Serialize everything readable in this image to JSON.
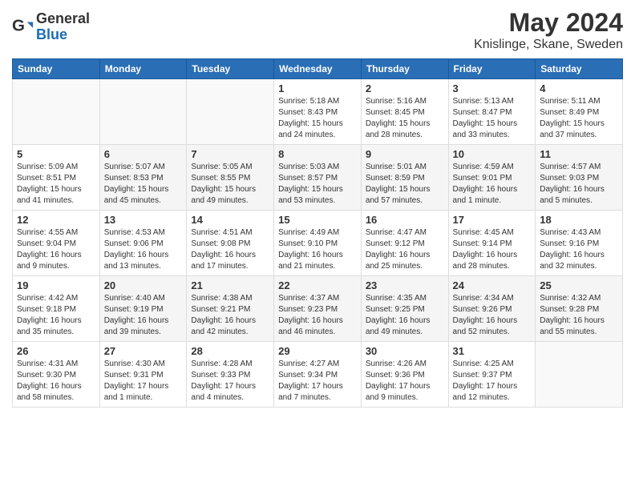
{
  "header": {
    "logo_general": "General",
    "logo_blue": "Blue",
    "main_title": "May 2024",
    "subtitle": "Knislinge, Skane, Sweden"
  },
  "weekdays": [
    "Sunday",
    "Monday",
    "Tuesday",
    "Wednesday",
    "Thursday",
    "Friday",
    "Saturday"
  ],
  "weeks": [
    [
      {
        "day": "",
        "info": ""
      },
      {
        "day": "",
        "info": ""
      },
      {
        "day": "",
        "info": ""
      },
      {
        "day": "1",
        "info": "Sunrise: 5:18 AM\nSunset: 8:43 PM\nDaylight: 15 hours\nand 24 minutes."
      },
      {
        "day": "2",
        "info": "Sunrise: 5:16 AM\nSunset: 8:45 PM\nDaylight: 15 hours\nand 28 minutes."
      },
      {
        "day": "3",
        "info": "Sunrise: 5:13 AM\nSunset: 8:47 PM\nDaylight: 15 hours\nand 33 minutes."
      },
      {
        "day": "4",
        "info": "Sunrise: 5:11 AM\nSunset: 8:49 PM\nDaylight: 15 hours\nand 37 minutes."
      }
    ],
    [
      {
        "day": "5",
        "info": "Sunrise: 5:09 AM\nSunset: 8:51 PM\nDaylight: 15 hours\nand 41 minutes."
      },
      {
        "day": "6",
        "info": "Sunrise: 5:07 AM\nSunset: 8:53 PM\nDaylight: 15 hours\nand 45 minutes."
      },
      {
        "day": "7",
        "info": "Sunrise: 5:05 AM\nSunset: 8:55 PM\nDaylight: 15 hours\nand 49 minutes."
      },
      {
        "day": "8",
        "info": "Sunrise: 5:03 AM\nSunset: 8:57 PM\nDaylight: 15 hours\nand 53 minutes."
      },
      {
        "day": "9",
        "info": "Sunrise: 5:01 AM\nSunset: 8:59 PM\nDaylight: 15 hours\nand 57 minutes."
      },
      {
        "day": "10",
        "info": "Sunrise: 4:59 AM\nSunset: 9:01 PM\nDaylight: 16 hours\nand 1 minute."
      },
      {
        "day": "11",
        "info": "Sunrise: 4:57 AM\nSunset: 9:03 PM\nDaylight: 16 hours\nand 5 minutes."
      }
    ],
    [
      {
        "day": "12",
        "info": "Sunrise: 4:55 AM\nSunset: 9:04 PM\nDaylight: 16 hours\nand 9 minutes."
      },
      {
        "day": "13",
        "info": "Sunrise: 4:53 AM\nSunset: 9:06 PM\nDaylight: 16 hours\nand 13 minutes."
      },
      {
        "day": "14",
        "info": "Sunrise: 4:51 AM\nSunset: 9:08 PM\nDaylight: 16 hours\nand 17 minutes."
      },
      {
        "day": "15",
        "info": "Sunrise: 4:49 AM\nSunset: 9:10 PM\nDaylight: 16 hours\nand 21 minutes."
      },
      {
        "day": "16",
        "info": "Sunrise: 4:47 AM\nSunset: 9:12 PM\nDaylight: 16 hours\nand 25 minutes."
      },
      {
        "day": "17",
        "info": "Sunrise: 4:45 AM\nSunset: 9:14 PM\nDaylight: 16 hours\nand 28 minutes."
      },
      {
        "day": "18",
        "info": "Sunrise: 4:43 AM\nSunset: 9:16 PM\nDaylight: 16 hours\nand 32 minutes."
      }
    ],
    [
      {
        "day": "19",
        "info": "Sunrise: 4:42 AM\nSunset: 9:18 PM\nDaylight: 16 hours\nand 35 minutes."
      },
      {
        "day": "20",
        "info": "Sunrise: 4:40 AM\nSunset: 9:19 PM\nDaylight: 16 hours\nand 39 minutes."
      },
      {
        "day": "21",
        "info": "Sunrise: 4:38 AM\nSunset: 9:21 PM\nDaylight: 16 hours\nand 42 minutes."
      },
      {
        "day": "22",
        "info": "Sunrise: 4:37 AM\nSunset: 9:23 PM\nDaylight: 16 hours\nand 46 minutes."
      },
      {
        "day": "23",
        "info": "Sunrise: 4:35 AM\nSunset: 9:25 PM\nDaylight: 16 hours\nand 49 minutes."
      },
      {
        "day": "24",
        "info": "Sunrise: 4:34 AM\nSunset: 9:26 PM\nDaylight: 16 hours\nand 52 minutes."
      },
      {
        "day": "25",
        "info": "Sunrise: 4:32 AM\nSunset: 9:28 PM\nDaylight: 16 hours\nand 55 minutes."
      }
    ],
    [
      {
        "day": "26",
        "info": "Sunrise: 4:31 AM\nSunset: 9:30 PM\nDaylight: 16 hours\nand 58 minutes."
      },
      {
        "day": "27",
        "info": "Sunrise: 4:30 AM\nSunset: 9:31 PM\nDaylight: 17 hours\nand 1 minute."
      },
      {
        "day": "28",
        "info": "Sunrise: 4:28 AM\nSunset: 9:33 PM\nDaylight: 17 hours\nand 4 minutes."
      },
      {
        "day": "29",
        "info": "Sunrise: 4:27 AM\nSunset: 9:34 PM\nDaylight: 17 hours\nand 7 minutes."
      },
      {
        "day": "30",
        "info": "Sunrise: 4:26 AM\nSunset: 9:36 PM\nDaylight: 17 hours\nand 9 minutes."
      },
      {
        "day": "31",
        "info": "Sunrise: 4:25 AM\nSunset: 9:37 PM\nDaylight: 17 hours\nand 12 minutes."
      },
      {
        "day": "",
        "info": ""
      }
    ]
  ]
}
